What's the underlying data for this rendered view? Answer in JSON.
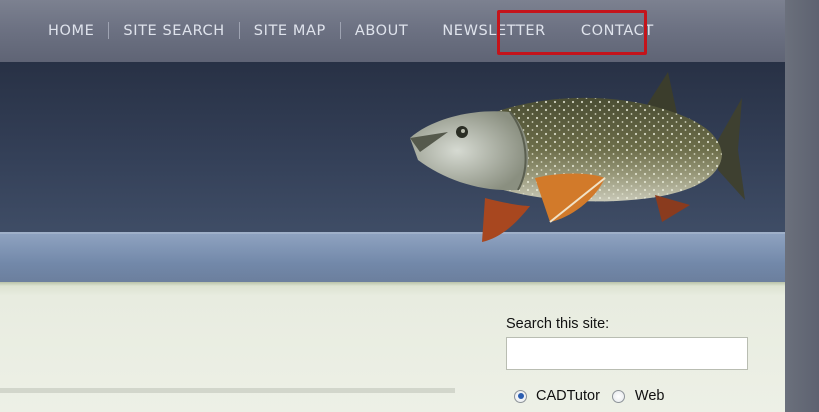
{
  "nav": {
    "items": [
      {
        "label": "HOME"
      },
      {
        "label": "SITE SEARCH"
      },
      {
        "label": "SITE MAP"
      },
      {
        "label": "ABOUT"
      },
      {
        "label": "NEWSLETTER"
      },
      {
        "label": "CONTACT"
      }
    ],
    "highlighted_item": "NEWSLETTER",
    "highlight_color": "#c4141b"
  },
  "sidebar": {
    "search_label": "Search this site:",
    "search_value": "",
    "options": [
      {
        "label": "CADTutor",
        "selected": true
      },
      {
        "label": "Web",
        "selected": false
      }
    ]
  },
  "banner": {
    "image": "lake-trout-fish-icon"
  }
}
